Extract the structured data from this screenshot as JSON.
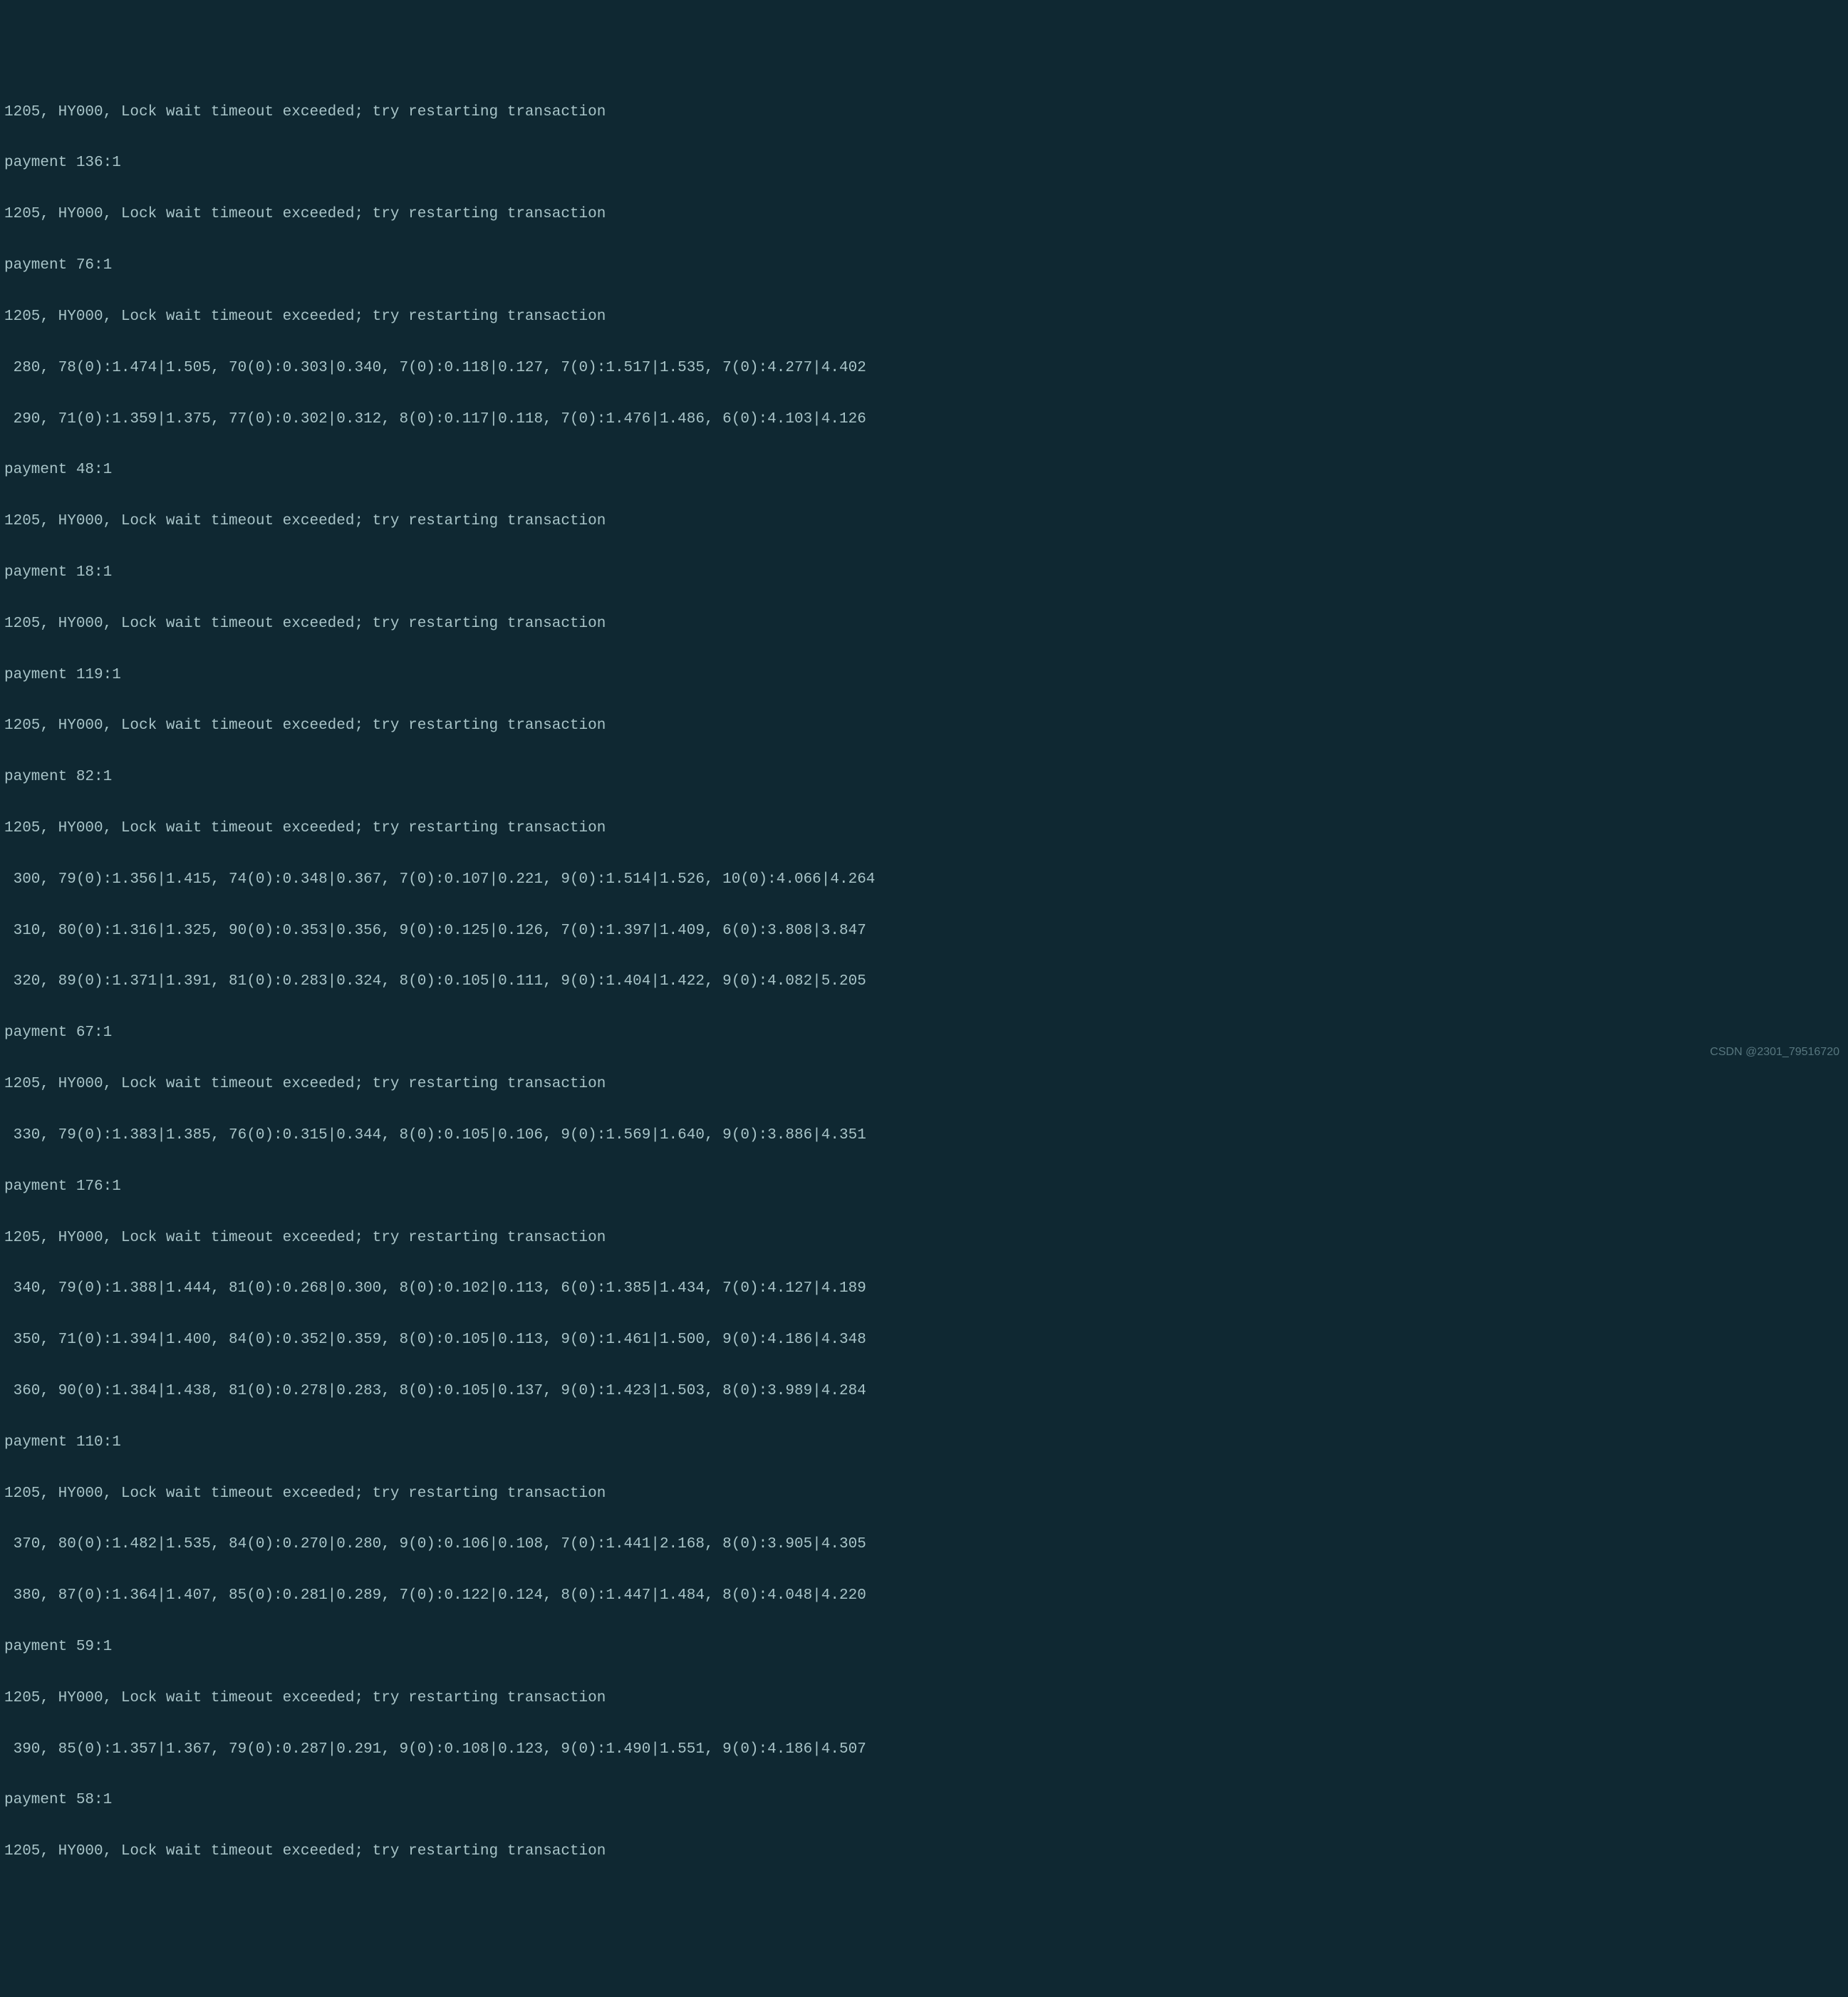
{
  "terminal": {
    "lines": [
      "1205, HY000, Lock wait timeout exceeded; try restarting transaction",
      "payment 136:1",
      "1205, HY000, Lock wait timeout exceeded; try restarting transaction",
      "payment 76:1",
      "1205, HY000, Lock wait timeout exceeded; try restarting transaction",
      " 280, 78(0):1.474|1.505, 70(0):0.303|0.340, 7(0):0.118|0.127, 7(0):1.517|1.535, 7(0):4.277|4.402",
      " 290, 71(0):1.359|1.375, 77(0):0.302|0.312, 8(0):0.117|0.118, 7(0):1.476|1.486, 6(0):4.103|4.126",
      "payment 48:1",
      "1205, HY000, Lock wait timeout exceeded; try restarting transaction",
      "payment 18:1",
      "1205, HY000, Lock wait timeout exceeded; try restarting transaction",
      "payment 119:1",
      "1205, HY000, Lock wait timeout exceeded; try restarting transaction",
      "payment 82:1",
      "1205, HY000, Lock wait timeout exceeded; try restarting transaction",
      " 300, 79(0):1.356|1.415, 74(0):0.348|0.367, 7(0):0.107|0.221, 9(0):1.514|1.526, 10(0):4.066|4.264",
      " 310, 80(0):1.316|1.325, 90(0):0.353|0.356, 9(0):0.125|0.126, 7(0):1.397|1.409, 6(0):3.808|3.847",
      " 320, 89(0):1.371|1.391, 81(0):0.283|0.324, 8(0):0.105|0.111, 9(0):1.404|1.422, 9(0):4.082|5.205",
      "payment 67:1",
      "1205, HY000, Lock wait timeout exceeded; try restarting transaction",
      " 330, 79(0):1.383|1.385, 76(0):0.315|0.344, 8(0):0.105|0.106, 9(0):1.569|1.640, 9(0):3.886|4.351",
      "payment 176:1",
      "1205, HY000, Lock wait timeout exceeded; try restarting transaction",
      " 340, 79(0):1.388|1.444, 81(0):0.268|0.300, 8(0):0.102|0.113, 6(0):1.385|1.434, 7(0):4.127|4.189",
      " 350, 71(0):1.394|1.400, 84(0):0.352|0.359, 8(0):0.105|0.113, 9(0):1.461|1.500, 9(0):4.186|4.348",
      " 360, 90(0):1.384|1.438, 81(0):0.278|0.283, 8(0):0.105|0.137, 9(0):1.423|1.503, 8(0):3.989|4.284",
      "payment 110:1",
      "1205, HY000, Lock wait timeout exceeded; try restarting transaction",
      " 370, 80(0):1.482|1.535, 84(0):0.270|0.280, 9(0):0.106|0.108, 7(0):1.441|2.168, 8(0):3.905|4.305",
      " 380, 87(0):1.364|1.407, 85(0):0.281|0.289, 7(0):0.122|0.124, 8(0):1.447|1.484, 8(0):4.048|4.220",
      "payment 59:1",
      "1205, HY000, Lock wait timeout exceeded; try restarting transaction",
      " 390, 85(0):1.357|1.367, 79(0):0.287|0.291, 9(0):0.108|0.123, 9(0):1.490|1.551, 9(0):4.186|4.507",
      "payment 58:1",
      "1205, HY000, Lock wait timeout exceeded; try restarting transaction"
    ]
  },
  "watermark": "CSDN @2301_79516720"
}
